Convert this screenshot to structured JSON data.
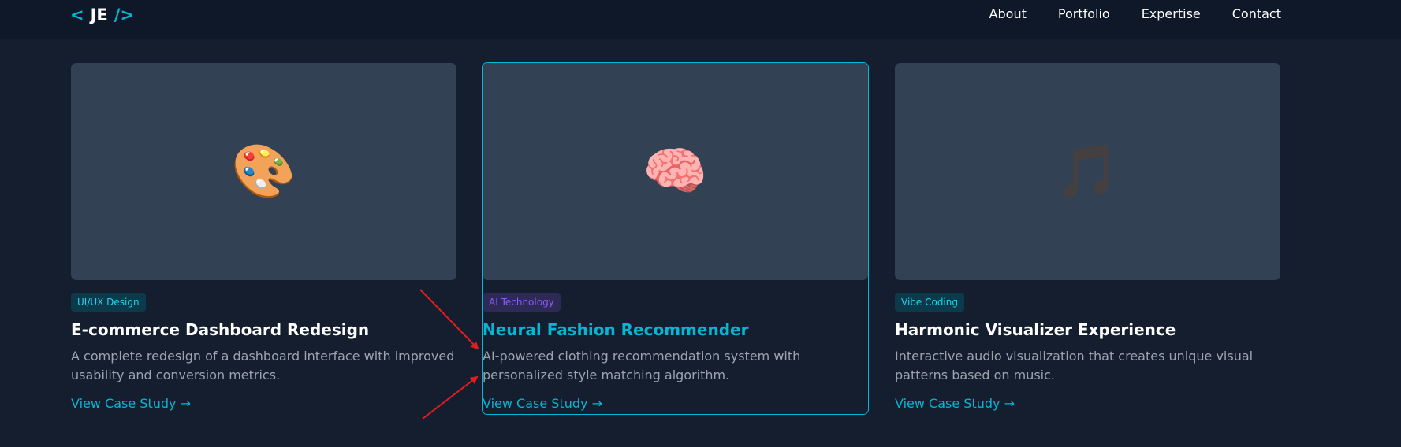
{
  "header": {
    "logo": {
      "open": "<",
      "initials": "JE",
      "close": "/>"
    },
    "nav": [
      {
        "label": "About"
      },
      {
        "label": "Portfolio"
      },
      {
        "label": "Expertise"
      },
      {
        "label": "Contact"
      }
    ]
  },
  "projects": [
    {
      "icon": "palette-icon",
      "emoji": "🎨",
      "tag": "UI/UX Design",
      "title": "E-commerce Dashboard Redesign",
      "description": "A complete redesign of a dashboard interface with improved usability and conversion metrics.",
      "link": "View Case Study →"
    },
    {
      "icon": "brain-icon",
      "emoji": "🧠",
      "tag": "AI Technology",
      "title": "Neural Fashion Recommender",
      "description": "AI-powered clothing recommendation system with personalized style matching algorithm.",
      "link": "View Case Study →"
    },
    {
      "icon": "music-note-icon",
      "emoji": "🎵",
      "tag": "Vibe Coding",
      "title": "Harmonic Visualizer Experience",
      "description": "Interactive audio visualization that creates unique visual patterns based on music.",
      "link": "View Case Study →"
    }
  ],
  "colors": {
    "accent": "#06b6d4",
    "background": "#141e2f",
    "card_image": "#334155",
    "annotation_arrow": "#e11d1d"
  }
}
